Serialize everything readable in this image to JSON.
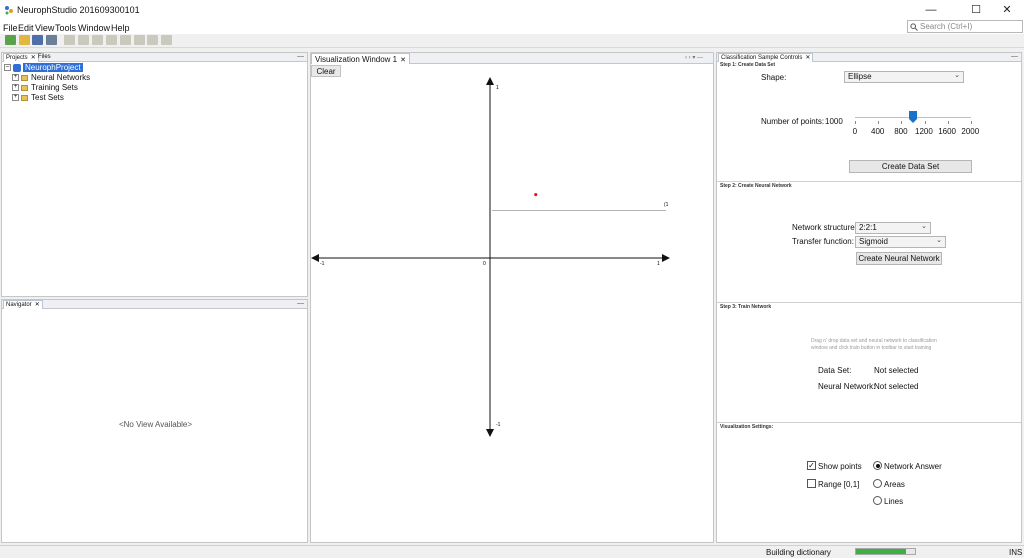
{
  "window": {
    "title": "NeurophStudio 201609300101"
  },
  "menu": [
    "File",
    "Edit",
    "View",
    "Tools",
    "Window",
    "Help"
  ],
  "search": {
    "placeholder": "Search (Ctrl+I)"
  },
  "projects_panel": {
    "tabs": [
      "Projects",
      "Files"
    ],
    "project_name": "NeurophProject",
    "items": [
      "Neural Networks",
      "Training Sets",
      "Test Sets"
    ]
  },
  "navigator_panel": {
    "tab": "Navigator",
    "empty_text": "<No View Available>"
  },
  "visualization": {
    "tab": "Visualization Window 1",
    "clear_label": "Clear",
    "axes": {
      "x_neg": "-1",
      "x_pos": "1",
      "origin": "0",
      "y_pos": "1",
      "y_neg": "-1",
      "point_label": "(1"
    },
    "point": {
      "x": 0.26,
      "y": 0.36,
      "color": "#e02020"
    },
    "line_y": 0.27
  },
  "controls": {
    "tab": "Classification Sample Controls",
    "step1": {
      "title": "Step 1: Create Data Set",
      "shape_label": "Shape:",
      "shape_value": "Ellipse",
      "points_label": "Number of points:",
      "points_value": "1000",
      "slider_value": 1000,
      "slider_min": 0,
      "slider_max": 2000,
      "slider_ticks": [
        "0",
        "400",
        "800",
        "1200",
        "1600",
        "2000"
      ],
      "create_button": "Create Data Set"
    },
    "step2": {
      "title": "Step 2: Create Neural Network",
      "structure_label": "Network structure:",
      "structure_value": "2:2:1",
      "transfer_label": "Transfer function:",
      "transfer_value": "Sigmoid",
      "create_button": "Create Neural Network"
    },
    "step3": {
      "title": "Step 3: Train Network",
      "hint": "Drag n' drop data set and neural network to classification window and click train button in toolbar to start training",
      "dataset_label": "Data Set:",
      "dataset_value": "Not selected",
      "network_label": "Neural Network:",
      "network_value": "Not selected"
    },
    "viz_settings": {
      "title": "Visualization Settings:",
      "show_points": "Show points",
      "range": "Range [0,1]",
      "network_answer": "Network Answer",
      "areas": "Areas",
      "lines": "Lines"
    }
  },
  "status": {
    "text": "Building dictionary",
    "mode": "INS",
    "progress": 0.85
  },
  "colors": {
    "accent": "#2f6fd6",
    "progress": "#3cb043"
  }
}
